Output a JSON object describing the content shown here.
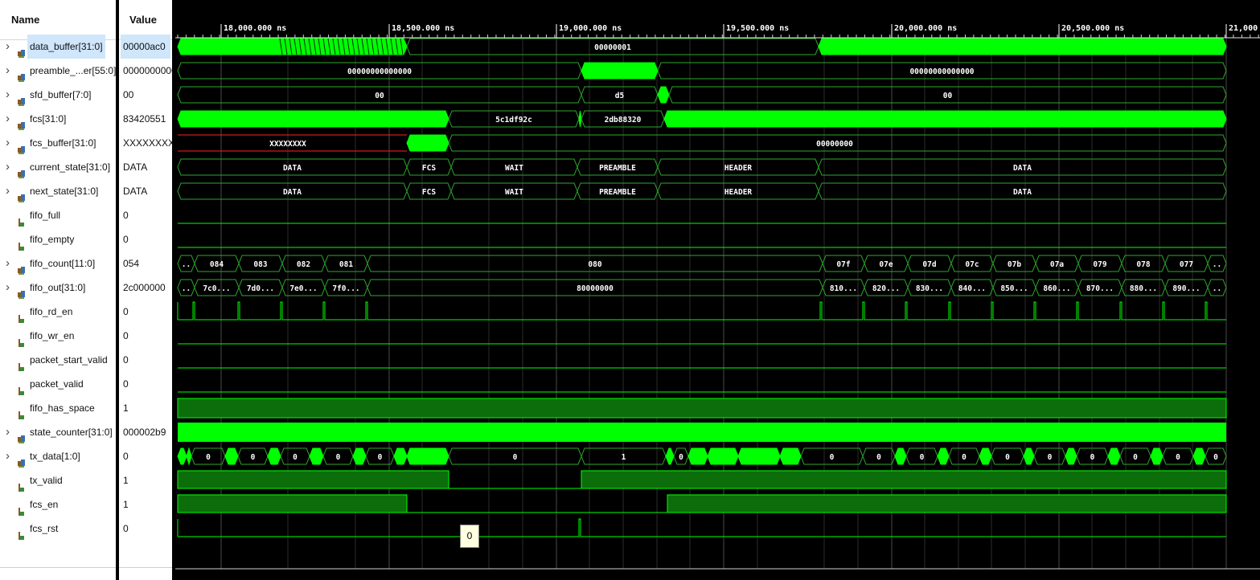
{
  "headers": {
    "name": "Name",
    "value": "Value"
  },
  "signals": [
    {
      "name": "data_buffer[31:0]",
      "value": "00000ac0",
      "bus": true,
      "selected": true,
      "icon": "bus-signal-icon"
    },
    {
      "name": "preamble_...er[55:0]",
      "value": "0000000000",
      "bus": true,
      "icon": "bus-signal-icon"
    },
    {
      "name": "sfd_buffer[7:0]",
      "value": "00",
      "bus": true,
      "icon": "bus-signal-icon"
    },
    {
      "name": "fcs[31:0]",
      "value": "83420551",
      "bus": true,
      "icon": "bus-signal-icon"
    },
    {
      "name": "fcs_buffer[31:0]",
      "value": "XXXXXXXX",
      "bus": true,
      "icon": "bus-signal-icon"
    },
    {
      "name": "current_state[31:0]",
      "value": "DATA",
      "bus": true,
      "icon": "bus-signal-icon"
    },
    {
      "name": "next_state[31:0]",
      "value": "DATA",
      "bus": true,
      "icon": "bus-signal-icon"
    },
    {
      "name": "fifo_full",
      "value": "0",
      "bus": false,
      "icon": "bit-signal-icon"
    },
    {
      "name": "fifo_empty",
      "value": "0",
      "bus": false,
      "icon": "bit-signal-icon"
    },
    {
      "name": "fifo_count[11:0]",
      "value": "054",
      "bus": true,
      "icon": "bus-signal-icon"
    },
    {
      "name": "fifo_out[31:0]",
      "value": "2c000000",
      "bus": true,
      "icon": "bus-signal-icon"
    },
    {
      "name": "fifo_rd_en",
      "value": "0",
      "bus": false,
      "icon": "bit-signal-icon"
    },
    {
      "name": "fifo_wr_en",
      "value": "0",
      "bus": false,
      "icon": "bit-signal-icon"
    },
    {
      "name": "packet_start_valid",
      "value": "0",
      "bus": false,
      "icon": "bit-signal-icon"
    },
    {
      "name": "packet_valid",
      "value": "0",
      "bus": false,
      "icon": "bit-signal-icon"
    },
    {
      "name": "fifo_has_space",
      "value": "1",
      "bus": false,
      "icon": "bit-signal-icon"
    },
    {
      "name": "state_counter[31:0]",
      "value": "000002b9",
      "bus": true,
      "icon": "bus-signal-icon"
    },
    {
      "name": "tx_data[1:0]",
      "value": "0",
      "bus": true,
      "icon": "bus-signal-icon"
    },
    {
      "name": "tx_valid",
      "value": "1",
      "bus": false,
      "icon": "bit-signal-icon"
    },
    {
      "name": "fcs_en",
      "value": "1",
      "bus": false,
      "icon": "bit-signal-icon"
    },
    {
      "name": "fcs_rst",
      "value": "0",
      "bus": false,
      "icon": "bit-signal-icon"
    }
  ],
  "timeline": {
    "ticks": [
      "18,000.000 ns",
      "18,500.000 ns",
      "19,000.000 ns",
      "19,500.000 ns",
      "20,000.000 ns",
      "20,500.000 ns",
      "21,000"
    ]
  },
  "bus_labels": {
    "data_buffer": [
      "00000001"
    ],
    "preamble": [
      "00000000000000",
      "00000000000000"
    ],
    "sfd": [
      "00",
      "d5",
      "00"
    ],
    "fcs": [
      "5c1df92c",
      "2db88320"
    ],
    "fcs_buffer": [
      "XXXXXXXX",
      "00000000"
    ],
    "current_state": [
      "DATA",
      "FCS",
      "WAIT",
      "PREAMBLE",
      "HEADER",
      "DATA"
    ],
    "next_state": [
      "DATA",
      "FCS",
      "WAIT",
      "PREAMBLE",
      "HEADER",
      "DATA"
    ],
    "fifo_count": [
      "..",
      "084",
      "083",
      "082",
      "081",
      "080",
      "07f",
      "07e",
      "07d",
      "07c",
      "07b",
      "07a",
      "079",
      "078",
      "077",
      ".."
    ],
    "fifo_out": [
      "..",
      "7c0...",
      "7d0...",
      "7e0...",
      "7f0...",
      "80000000",
      "810...",
      "820...",
      "830...",
      "840...",
      "850...",
      "860...",
      "870...",
      "880...",
      "890...",
      ".."
    ],
    "tx_data": [
      "0",
      "0",
      "0",
      "0",
      "0",
      "0",
      "1",
      "0",
      "0",
      "0",
      "0",
      "0",
      "0",
      "0",
      "0",
      "0",
      "0",
      "0"
    ]
  },
  "tooltip": "0",
  "colors": {
    "background": "#000000",
    "signal": "#00ff00",
    "bus_outline": "#2fa82f",
    "grid": "#4a4a4a",
    "filled_level": "#0b6e0b",
    "undefined": "#ff2020"
  }
}
